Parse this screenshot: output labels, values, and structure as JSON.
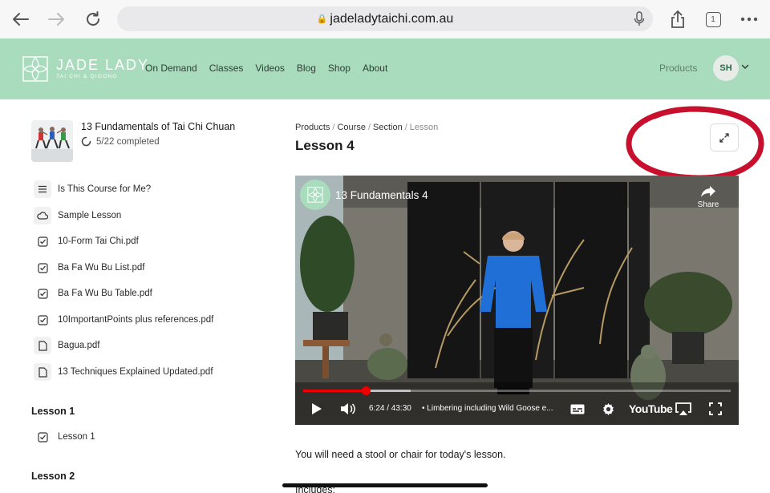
{
  "browser": {
    "url": "jadeladytaichi.com.au",
    "tab_count": "1"
  },
  "site": {
    "logo_title": "JADE LADY",
    "logo_subtitle": "TAI CHI & QIGONG",
    "nav": [
      "On Demand",
      "Classes",
      "Videos",
      "Blog",
      "Shop",
      "About"
    ],
    "products_link": "Products",
    "avatar_initials": "SH",
    "brand_color": "#a8dcbc"
  },
  "sidebar": {
    "course_title": "13 Fundamentals of Tai Chi Chuan",
    "course_progress": "5/22 completed",
    "items": [
      {
        "label": "Is This Course for Me?",
        "icon": "list-icon"
      },
      {
        "label": "Sample Lesson",
        "icon": "cloud-icon"
      },
      {
        "label": "10-Form Tai Chi.pdf",
        "icon": "checkbox-icon"
      },
      {
        "label": "Ba Fa Wu Bu List.pdf",
        "icon": "checkbox-icon"
      },
      {
        "label": "Ba Fa Wu Bu Table.pdf",
        "icon": "checkbox-icon"
      },
      {
        "label": "10ImportantPoints plus references.pdf",
        "icon": "checkbox-icon"
      },
      {
        "label": "Bagua.pdf",
        "icon": "document-icon"
      },
      {
        "label": "13 Techniques Explained Updated.pdf",
        "icon": "document-icon"
      }
    ],
    "sections": [
      {
        "heading": "Lesson 1",
        "items": [
          {
            "label": "Lesson 1",
            "icon": "checkbox-icon"
          }
        ]
      },
      {
        "heading": "Lesson 2",
        "items": []
      }
    ]
  },
  "main": {
    "breadcrumb": [
      "Products",
      "Course",
      "Section",
      "Lesson"
    ],
    "title": "Lesson 4",
    "video": {
      "title": "13 Fundamentals 4",
      "share_label": "Share",
      "time": "6:24 / 43:30",
      "chapter": "• Limbering including Wild Goose e...",
      "brand": "YouTube",
      "progress": 0.147,
      "buffered": 0.252
    },
    "body_text": "You will need a stool or chair for today's lesson.",
    "includes_label": "Includes:"
  }
}
